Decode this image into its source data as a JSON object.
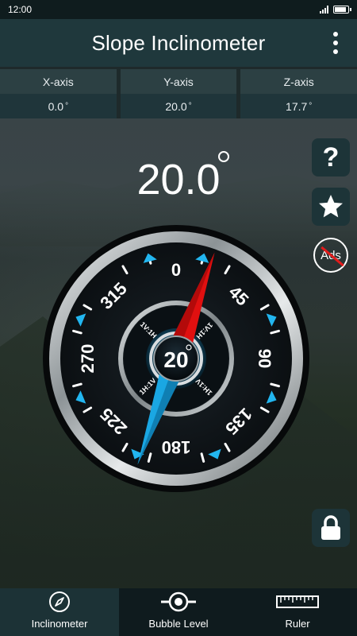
{
  "status_bar": {
    "time": "12:00"
  },
  "app_bar": {
    "title": "Slope Inclinometer"
  },
  "axes": [
    {
      "label": "X-axis",
      "value": "0.0",
      "unit": "°"
    },
    {
      "label": "Y-axis",
      "value": "20.0",
      "unit": "°"
    },
    {
      "label": "Z-axis",
      "value": "17.7",
      "unit": "°"
    }
  ],
  "main_reading": {
    "value": "20.0"
  },
  "side_buttons": {
    "help_label": "?",
    "ads_label": "Ads"
  },
  "gauge": {
    "center_value": "20",
    "angle_deg": 20,
    "labels": [
      "0",
      "45",
      "90",
      "135",
      "180",
      "225",
      "270",
      "315"
    ],
    "inner_ratio_labels": [
      "1V:1H",
      "1V:1H",
      "1H:1V",
      "1H:1V"
    ],
    "colors": {
      "needle_north": "#e01010",
      "needle_south": "#1aa7e3",
      "accent": "#22b6f0"
    }
  },
  "bottom_nav": [
    {
      "label": "Inclinometer",
      "icon": "compass-icon",
      "active": true
    },
    {
      "label": "Bubble Level",
      "icon": "bubble-level-icon",
      "active": false
    },
    {
      "label": "Ruler",
      "icon": "ruler-icon",
      "active": false
    }
  ]
}
